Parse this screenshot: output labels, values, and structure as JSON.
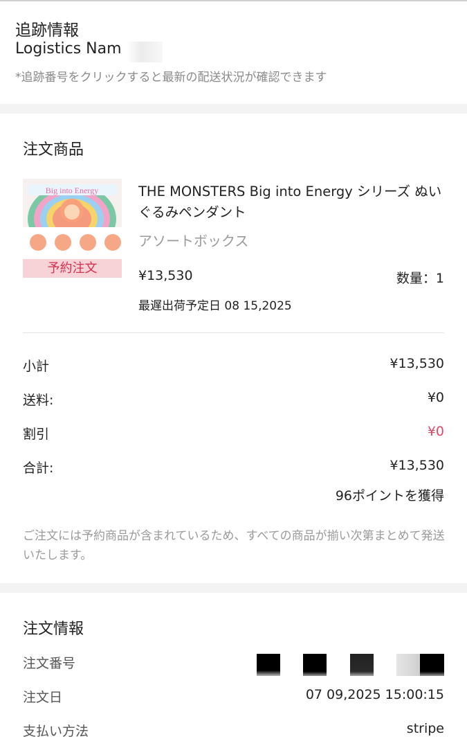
{
  "tracking": {
    "title": "追跡情報",
    "logistics_name": "Logistics Nam",
    "note": "*追跡番号をクリックすると最新の配送状況が確認できます"
  },
  "order_items": {
    "heading": "注文商品",
    "product": {
      "name": "THE MONSTERS Big into Energy シリーズ ぬいぐるみペンダント",
      "variant": "アソートボックス",
      "price": "¥13,530",
      "quantity_label": "数量：",
      "quantity": "1",
      "latest_ship_label": "最遅出荷予定日",
      "latest_ship_date": "08 15,2025",
      "badge": "予約注文",
      "thumbnail_text": "Big into Energy"
    }
  },
  "summary": {
    "subtotal_label": "小計",
    "subtotal": "¥13,530",
    "shipping_label": "送料:",
    "shipping": "¥0",
    "discount_label": "割引",
    "discount": "¥0",
    "total_label": "合計:",
    "total": "¥13,530",
    "points": "96ポイントを獲得",
    "notice": "ご注文には予約商品が含まれているため、すべての商品が揃い次第まとめて発送いたします。"
  },
  "order_info": {
    "heading": "注文情報",
    "number_label": "注文番号",
    "date_label": "注文日",
    "date": "07 09,2025 15:00:15",
    "payment_label": "支払い方法",
    "payment": "stripe"
  },
  "colors": {
    "accent_red": "#e0486a",
    "badge_bg": "#f7d3d7",
    "muted_text": "#9a9a9a",
    "section_gap": "#f3f3f3"
  }
}
